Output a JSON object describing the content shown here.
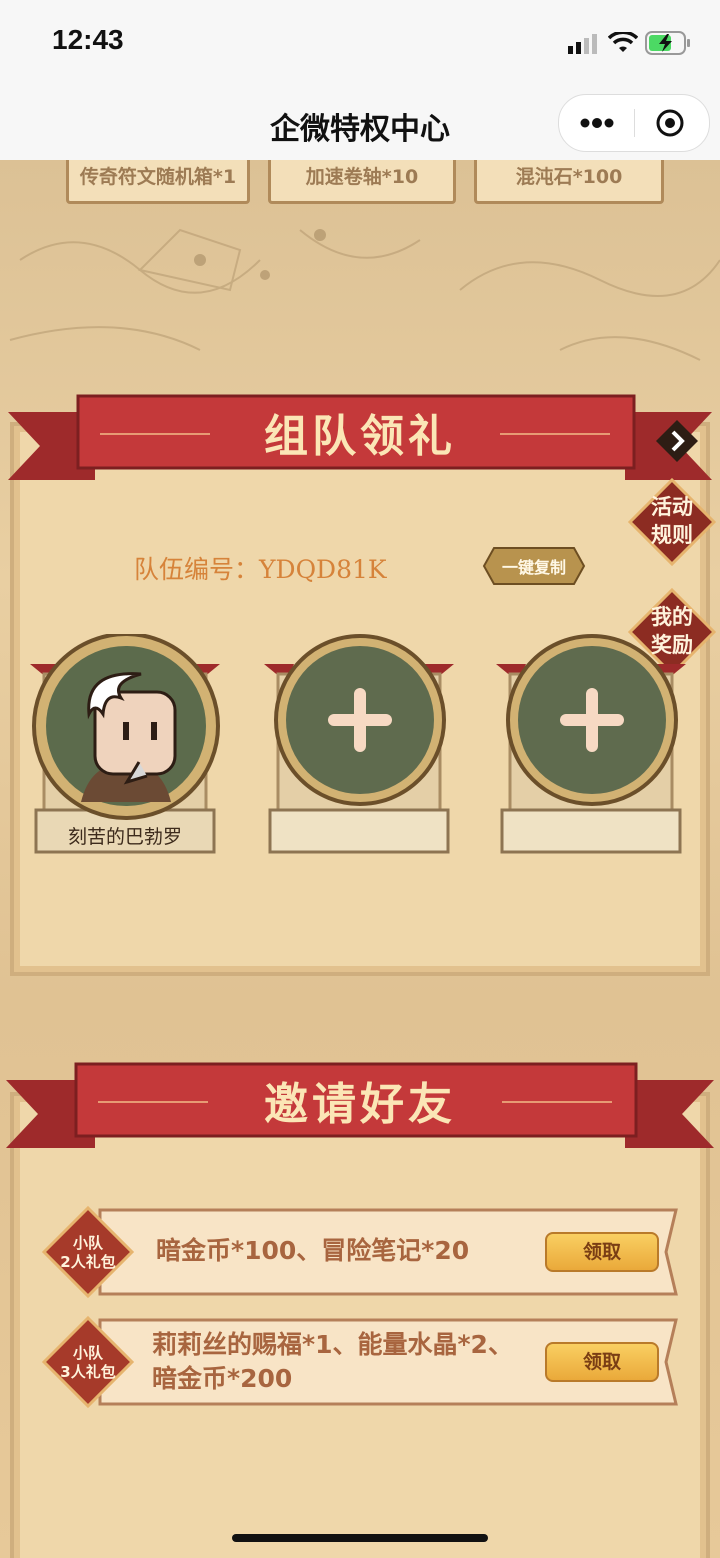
{
  "status_bar": {
    "time": "12:43"
  },
  "nav": {
    "title": "企微特权中心"
  },
  "top_rewards": [
    {
      "label": "传奇符文随机箱*1"
    },
    {
      "label": "加速卷轴*10"
    },
    {
      "label": "混沌石*100"
    }
  ],
  "team_section": {
    "title": "组队领礼",
    "team_id_label": "队伍编号：",
    "team_id": "YDQD81K",
    "copy_button": "一键复制",
    "side_buttons": {
      "rules": "活动\n规则",
      "my_rewards": "我的\n奖励"
    },
    "members": [
      {
        "name": "刻苦的巴勃罗",
        "filled": true
      },
      {
        "name": "",
        "filled": false
      },
      {
        "name": "",
        "filled": false
      }
    ]
  },
  "invite_section": {
    "title": "邀请好友",
    "rewards": [
      {
        "badge_line1": "小队",
        "badge_line2": "2人礼包",
        "text": "暗金币*100、冒险笔记*20",
        "button": "领取"
      },
      {
        "badge_line1": "小队",
        "badge_line2": "3人礼包",
        "text": "莉莉丝的赐福*1、能量水晶*2、\n暗金币*200",
        "button": "领取"
      }
    ]
  },
  "colors": {
    "ribbon": "#c4393a",
    "accent_text": "#d6833a",
    "button": "#eaa93a"
  }
}
